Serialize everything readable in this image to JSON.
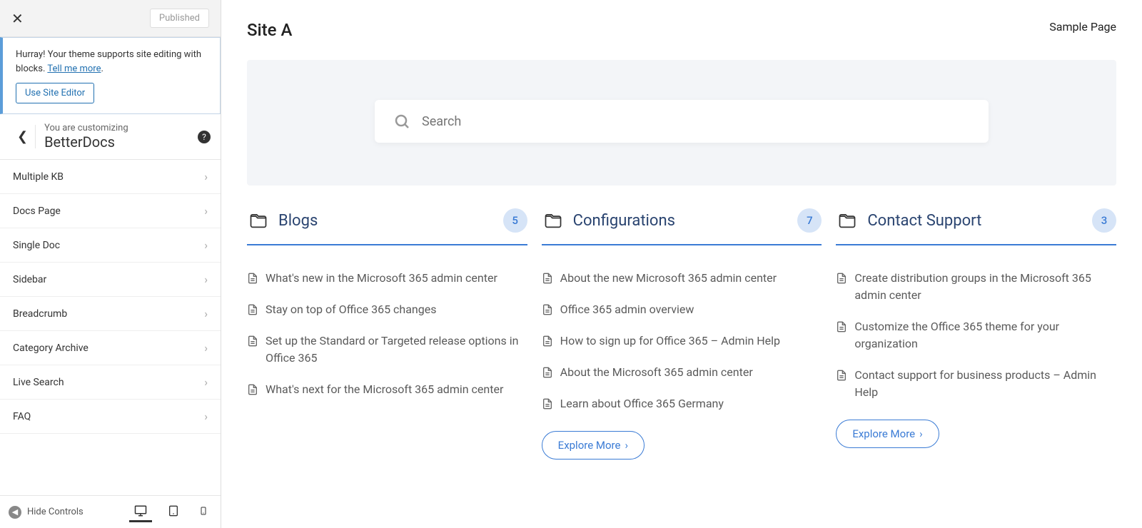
{
  "sidebar": {
    "published_label": "Published",
    "notice_prefix": "Hurray! Your theme supports site editing with blocks. ",
    "notice_link": "Tell me more",
    "site_editor_btn": "Use Site Editor",
    "customizing_label": "You are customizing",
    "customizing_title": "BetterDocs",
    "menu": [
      "Multiple KB",
      "Docs Page",
      "Single Doc",
      "Sidebar",
      "Breadcrumb",
      "Category Archive",
      "Live Search",
      "FAQ"
    ],
    "hide_controls": "Hide Controls"
  },
  "preview": {
    "site_title": "Site A",
    "site_link": "Sample Page",
    "search_placeholder": "Search",
    "explore_label": "Explore More",
    "cards": [
      {
        "title": "Blogs",
        "count": "5",
        "docs": [
          "What's new in the Microsoft 365 admin center",
          "Stay on top of Office 365 changes",
          "Set up the Standard or Targeted release options in Office 365",
          "What's next for the Microsoft 365 admin center"
        ],
        "show_explore": false
      },
      {
        "title": "Configurations",
        "count": "7",
        "docs": [
          "About the new Microsoft 365 admin center",
          "Office 365 admin overview",
          "How to sign up for Office 365 – Admin Help",
          "About the Microsoft 365 admin center",
          "Learn about Office 365 Germany"
        ],
        "show_explore": true
      },
      {
        "title": "Contact Support",
        "count": "3",
        "docs": [
          "Create distribution groups in the Microsoft 365 admin center",
          "Customize the Office 365 theme for your organization",
          "Contact support for business products – Admin Help"
        ],
        "show_explore": true
      }
    ]
  }
}
